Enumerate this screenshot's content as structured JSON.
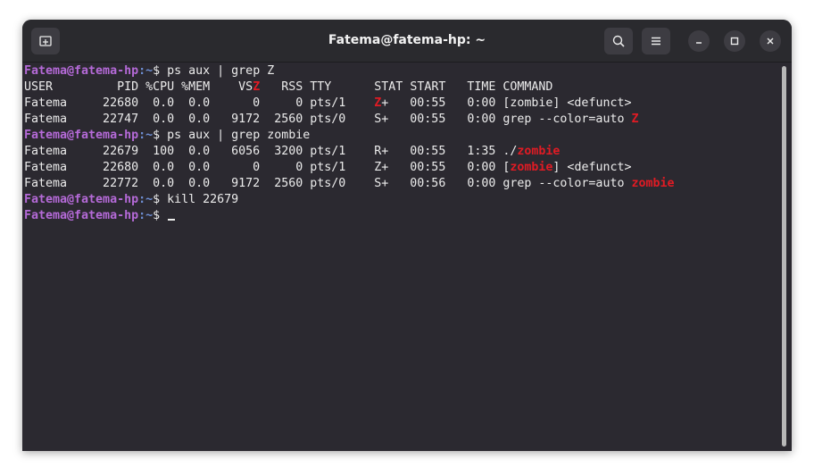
{
  "window": {
    "title": "Fatema@fatema-hp: ~"
  },
  "icons": {
    "new_tab": "new-tab-icon",
    "search": "search-icon",
    "menu": "hamburger-menu-icon",
    "minimize": "minimize-icon",
    "maximize": "maximize-icon",
    "close": "close-icon"
  },
  "colors": {
    "prompt_user": "#b56ad8",
    "prompt_path": "#6e8fd4",
    "grep_match": "#e01b24",
    "text": "#ececec",
    "background": "#2b2930"
  },
  "terminal": {
    "prompt": {
      "user_host": "Fatema@fatema-hp",
      "path": ":~",
      "symbol": "$ "
    },
    "lines": [
      {
        "type": "prompt",
        "command": "ps aux | grep Z"
      },
      {
        "type": "out",
        "segments": [
          [
            "USER         PID %CPU %MEM    VS",
            false
          ],
          [
            "Z",
            true
          ],
          [
            "   RSS TTY      STAT START   TIME COMMAND",
            false
          ]
        ]
      },
      {
        "type": "out",
        "segments": [
          [
            "Fatema     22680  0.0  0.0      0     0 pts/1    ",
            false
          ],
          [
            "Z",
            true
          ],
          [
            "+   00:55   0:00 [zombie] <defunct>",
            false
          ]
        ]
      },
      {
        "type": "out",
        "segments": [
          [
            "Fatema     22747  0.0  0.0   9172  2560 pts/0    S+   00:55   0:00 grep --color=auto ",
            false
          ],
          [
            "Z",
            true
          ]
        ]
      },
      {
        "type": "prompt",
        "command": "ps aux | grep zombie"
      },
      {
        "type": "out",
        "segments": [
          [
            "Fatema     22679  100  0.0   6056  3200 pts/1    R+   00:55   1:35 ./",
            false
          ],
          [
            "zombie",
            true
          ]
        ]
      },
      {
        "type": "out",
        "segments": [
          [
            "Fatema     22680  0.0  0.0      0     0 pts/1    Z+   00:55   0:00 [",
            false
          ],
          [
            "zombie",
            true
          ],
          [
            "] <defunct>",
            false
          ]
        ]
      },
      {
        "type": "out",
        "segments": [
          [
            "Fatema     22772  0.0  0.0   9172  2560 pts/0    S+   00:56   0:00 grep --color=auto ",
            false
          ],
          [
            "zombie",
            true
          ]
        ]
      },
      {
        "type": "prompt",
        "command": "kill 22679"
      },
      {
        "type": "prompt",
        "command": "",
        "cursor": true
      }
    ]
  }
}
